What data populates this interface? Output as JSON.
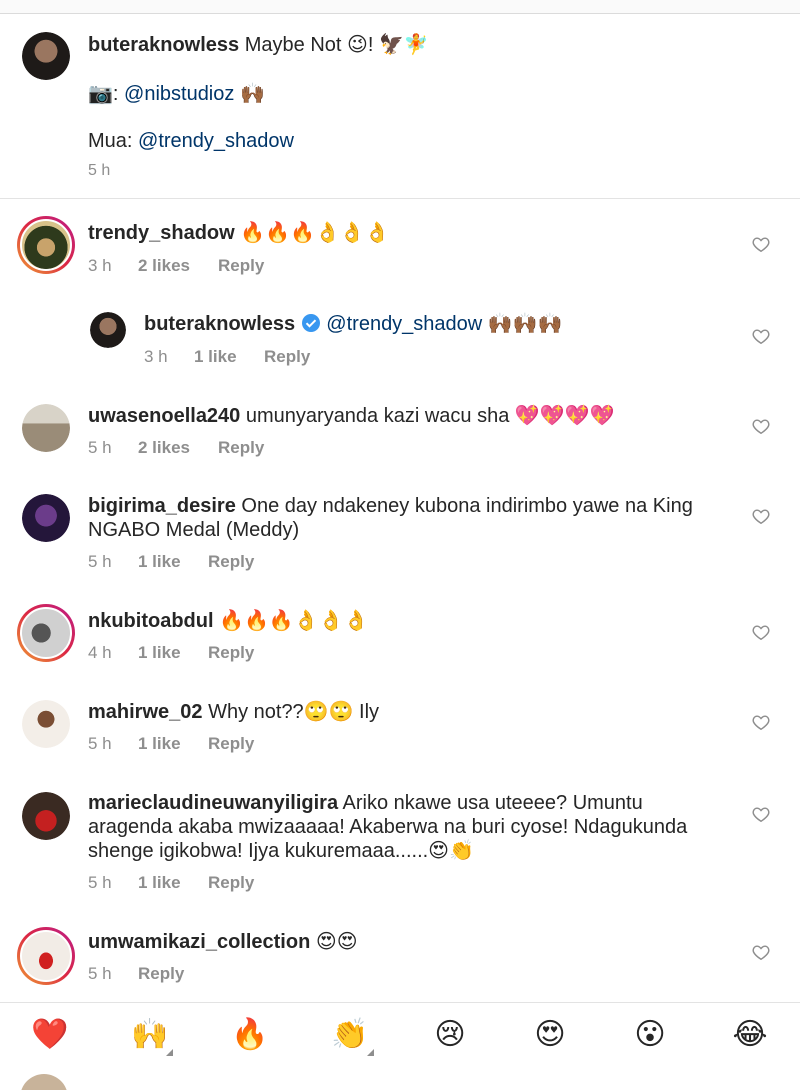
{
  "caption": {
    "username": "buteraknowless",
    "text": "Maybe Not 😉! 🦅🧚",
    "photo_credit_prefix": "📷: ",
    "photo_credit_mention": "@nibstudioz",
    "photo_credit_suffix": " 🙌🏾",
    "mua_prefix": "Mua: ",
    "mua_mention": "@trendy_shadow",
    "time": "5 h"
  },
  "comments": [
    {
      "username": "trendy_shadow",
      "text": "🔥🔥🔥👌👌👌",
      "time": "3 h",
      "likes": "2 likes",
      "reply": "Reply"
    },
    {
      "username": "buteraknowless",
      "verified": true,
      "mention": "@trendy_shadow",
      "text": " 🙌🏾🙌🏾🙌🏾",
      "time": "3 h",
      "likes": "1 like",
      "reply": "Reply"
    },
    {
      "username": "uwasenoella240",
      "text": "umunyaryanda kazi wacu sha 💖💖💖💖",
      "time": "5 h",
      "likes": "2 likes",
      "reply": "Reply"
    },
    {
      "username": "bigirima_desire",
      "text": "One day ndakeney kubona indirimbo yawe na King",
      "text2": "NGABO Medal (Meddy)",
      "time": "5 h",
      "likes": "1 like",
      "reply": "Reply"
    },
    {
      "username": "nkubitoabdul",
      "text": "🔥🔥🔥👌👌👌",
      "time": "4 h",
      "likes": "1 like",
      "reply": "Reply"
    },
    {
      "username": "mahirwe_02",
      "text": "Why not??🙄🙄 Ily",
      "time": "5 h",
      "likes": "1 like",
      "reply": "Reply"
    },
    {
      "username": "marieclaudineuwanyiligira",
      "text": "Ariko nkawe usa uteeee? Umuntu",
      "text2": "aragenda akaba mwizaaaaa! Akaberwa na buri cyose! Ndagukunda",
      "text3": "shenge igikobwa! Ijya kukuremaaa......😍👏",
      "time": "5 h",
      "likes": "1 like",
      "reply": "Reply"
    },
    {
      "username": "umwamikazi_collection",
      "text": "😍😍",
      "time": "5 h",
      "reply": "Reply"
    }
  ],
  "emoji_bar": [
    {
      "icon": "heart-emoji",
      "glyph": "❤️"
    },
    {
      "icon": "raised-hands-emoji",
      "glyph": "🙌"
    },
    {
      "icon": "fire-emoji",
      "glyph": "🔥"
    },
    {
      "icon": "clapping-emoji",
      "glyph": "👏"
    },
    {
      "icon": "crying-emoji",
      "glyph": "😢"
    },
    {
      "icon": "heart-eyes-emoji",
      "glyph": "😍"
    },
    {
      "icon": "surprised-emoji",
      "glyph": "😮"
    },
    {
      "icon": "laughing-emoji",
      "glyph": "😂"
    }
  ],
  "colors": {
    "mention": "#003569",
    "muted": "#8e8e8e",
    "verified": "#3897f0",
    "divider": "#e3e3e3"
  }
}
